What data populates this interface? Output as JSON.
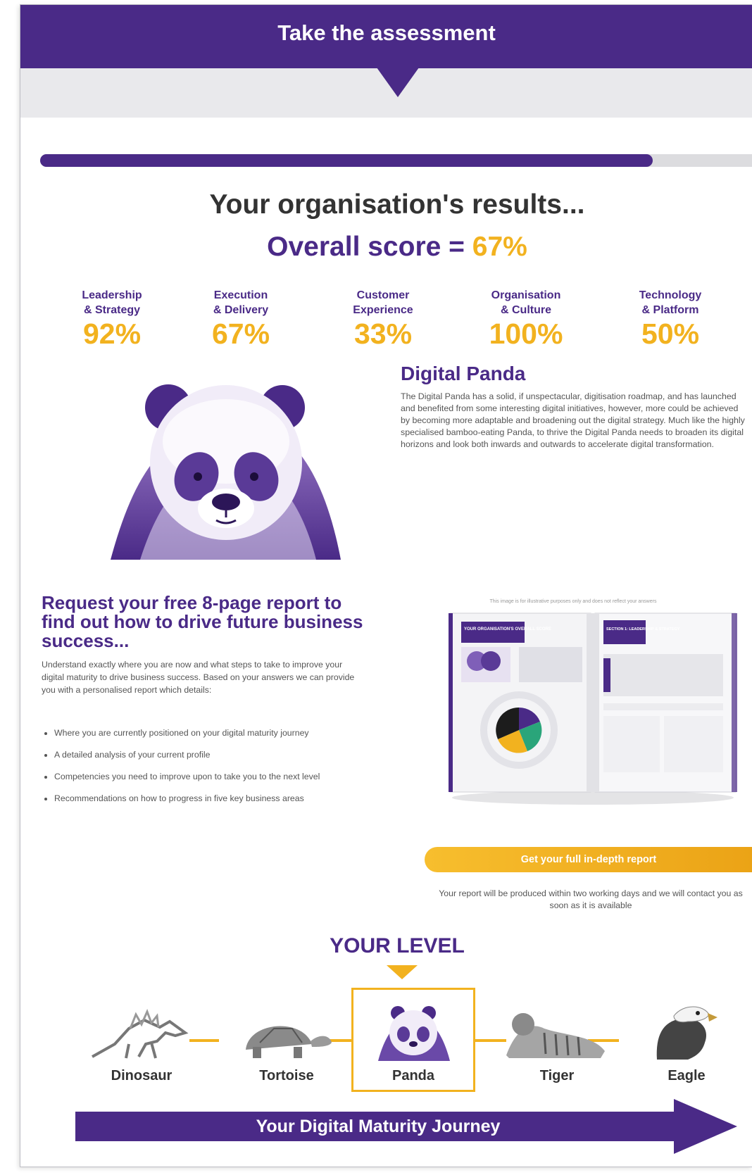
{
  "header": {
    "title": "Take the assessment"
  },
  "progress": {
    "percent": 86
  },
  "results": {
    "title": "Your organisation's results...",
    "overall_label": "Overall score = ",
    "overall_value": "67%"
  },
  "categories": [
    {
      "name": "Leadership\n& Strategy",
      "value": "92%"
    },
    {
      "name": "Execution\n& Delivery",
      "value": "67%"
    },
    {
      "name": "Customer\nExperience",
      "value": "33%"
    },
    {
      "name": "Organisation\n& Culture",
      "value": "100%"
    },
    {
      "name": "Technology\n& Platform",
      "value": "50%"
    }
  ],
  "profile": {
    "title": "Digital Panda",
    "description": "The Digital Panda has a solid, if unspectacular, digitisation roadmap, and has launched and benefited from some interesting digital initiatives, however, more could be achieved by becoming more adaptable and broadening out the digital strategy. Much like the highly specialised bamboo-eating Panda, to thrive the Digital Panda needs to broaden its digital horizons and look both inwards and outwards to accelerate digital transformation."
  },
  "request": {
    "title": "Request your free 8-page report to find out how to drive future business success...",
    "intro": "Understand exactly where you are now and what steps to take to improve your digital maturity to drive business success. Based on your answers we can provide you with a personalised report which details:",
    "bullets": [
      "Where you are currently positioned on your digital maturity journey",
      "A detailed analysis of your current profile",
      "Competencies you need to improve upon to take you to the next level",
      "Recommendations on how to progress in five key business areas"
    ]
  },
  "report": {
    "disclaimer": "This image is for illustrative purposes only and does not reflect your answers",
    "cover_heading": "YOUR ORGANISATION'S OVERALL SCORE",
    "section_heading": "SECTION 1: LEADERSHIP & STRATEGY"
  },
  "cta": {
    "label": "Get your full in-depth report",
    "note": "Your report will be produced within two working days and we will contact you as soon as it is available"
  },
  "levels": {
    "title": "YOUR LEVEL",
    "items": [
      "Dinosaur",
      "Tortoise",
      "Panda",
      "Tiger",
      "Eagle"
    ],
    "current": "Panda"
  },
  "journey": {
    "label": "Your Digital Maturity Journey"
  },
  "colors": {
    "purple": "#4a2a87",
    "gold": "#f2b21f",
    "gray_band": "#e9e9ec"
  }
}
